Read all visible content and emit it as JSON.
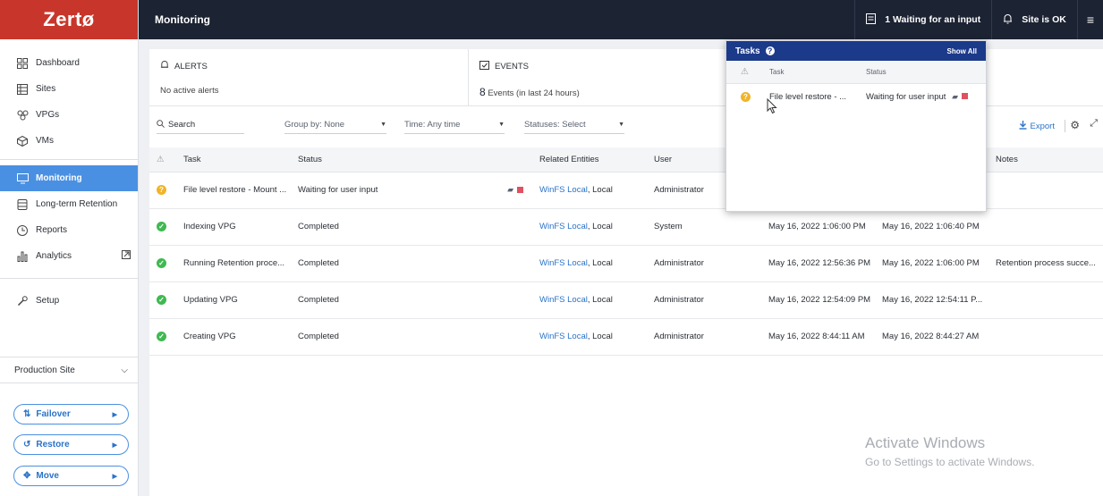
{
  "brand": "Zertø",
  "header": {
    "title": "Monitoring",
    "waiting": "1 Waiting for an input",
    "site_status": "Site is OK"
  },
  "sidebar": {
    "items": [
      {
        "label": "Dashboard",
        "icon": "dashboard-icon"
      },
      {
        "label": "Sites",
        "icon": "sites-icon"
      },
      {
        "label": "VPGs",
        "icon": "vpg-icon"
      },
      {
        "label": "VMs",
        "icon": "vm-icon"
      },
      {
        "label": "Monitoring",
        "icon": "monitor-icon"
      },
      {
        "label": "Long-term Retention",
        "icon": "database-icon"
      },
      {
        "label": "Reports",
        "icon": "clock-icon"
      },
      {
        "label": "Analytics",
        "icon": "chart-icon"
      },
      {
        "label": "Setup",
        "icon": "wrench-icon"
      }
    ],
    "site": "Production Site",
    "actions": [
      "Failover",
      "Restore",
      "Move"
    ]
  },
  "summary": {
    "alerts_title": "ALERTS",
    "alerts_text": "No active alerts",
    "events_title": "EVENTS",
    "events_count": "8",
    "events_text": "Events (in last 24 hours)"
  },
  "filters": {
    "search": "Search",
    "group_by": "Group by: None",
    "time": "Time: Any time",
    "statuses": "Statuses: Select",
    "export": "Export"
  },
  "table": {
    "headers": [
      "Task",
      "Status",
      "Related Entities",
      "User",
      "",
      "",
      "Notes"
    ],
    "rows": [
      {
        "state": "warn",
        "task": "File level restore - Mount ...",
        "status": "Waiting for user input",
        "entity_link": "WinFS Local",
        "entity_rest": ", Local",
        "user": "Administrator",
        "start": "",
        "end": "",
        "notes": ""
      },
      {
        "state": "ok",
        "task": "Indexing VPG",
        "status": "Completed",
        "entity_link": "WinFS Local",
        "entity_rest": ", Local",
        "user": "System",
        "start": "May 16, 2022 1:06:00 PM",
        "end": "May 16, 2022 1:06:40 PM",
        "notes": ""
      },
      {
        "state": "ok",
        "task": "Running Retention proce...",
        "status": "Completed",
        "entity_link": "WinFS Local",
        "entity_rest": ", Local",
        "user": "Administrator",
        "start": "May 16, 2022 12:56:36 PM",
        "end": "May 16, 2022 1:06:00 PM",
        "notes": "Retention process succe..."
      },
      {
        "state": "ok",
        "task": "Updating VPG",
        "status": "Completed",
        "entity_link": "WinFS Local",
        "entity_rest": ", Local",
        "user": "Administrator",
        "start": "May 16, 2022 12:54:09 PM",
        "end": "May 16, 2022 12:54:11 P...",
        "notes": ""
      },
      {
        "state": "ok",
        "task": "Creating VPG",
        "status": "Completed",
        "entity_link": "WinFS Local",
        "entity_rest": ", Local",
        "user": "Administrator",
        "start": "May 16, 2022 8:44:11 AM",
        "end": "May 16, 2022 8:44:27 AM",
        "notes": ""
      }
    ]
  },
  "tasks_popup": {
    "title": "Tasks",
    "show_all": "Show All",
    "col_task": "Task",
    "col_status": "Status",
    "row_task": "File level restore - ...",
    "row_status": "Waiting for user input"
  },
  "watermark": {
    "line1": "Activate Windows",
    "line2": "Go to Settings to activate Windows."
  },
  "colors": {
    "brand": "#c8362b",
    "topbar": "#1c2333",
    "active": "#4a90e2",
    "ok": "#3fb950",
    "warn": "#f0b429",
    "popup_header": "#1c3a8a"
  }
}
